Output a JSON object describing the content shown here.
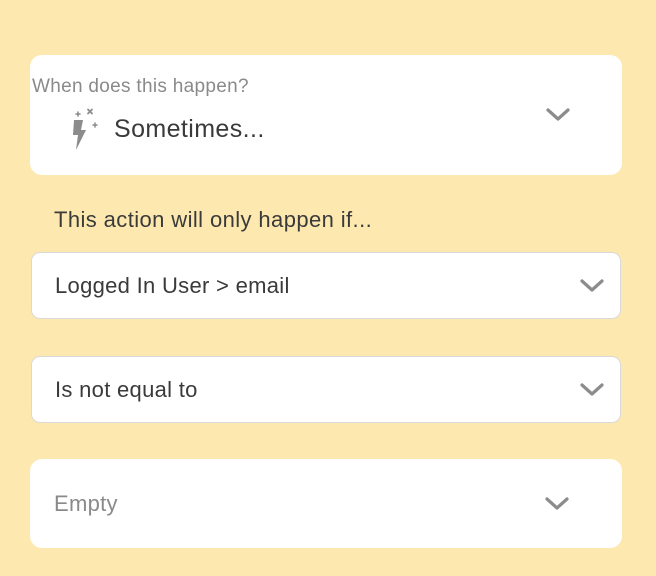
{
  "trigger": {
    "question": "When does this happen?",
    "value": "Sometimes..."
  },
  "condition": {
    "hint": "This action will only happen if...",
    "field": "Logged In User > email",
    "operator": "Is not equal to",
    "value_placeholder": "Empty"
  },
  "icons": {
    "trigger_icon": "magic-lightning-icon",
    "dropdown_icon": "chevron-down-icon"
  },
  "colors": {
    "background": "#fde9b0",
    "card": "#ffffff",
    "text": "#3a3a3a",
    "muted_text": "#8a8a8a",
    "icon_gray": "#8c8c8c"
  }
}
